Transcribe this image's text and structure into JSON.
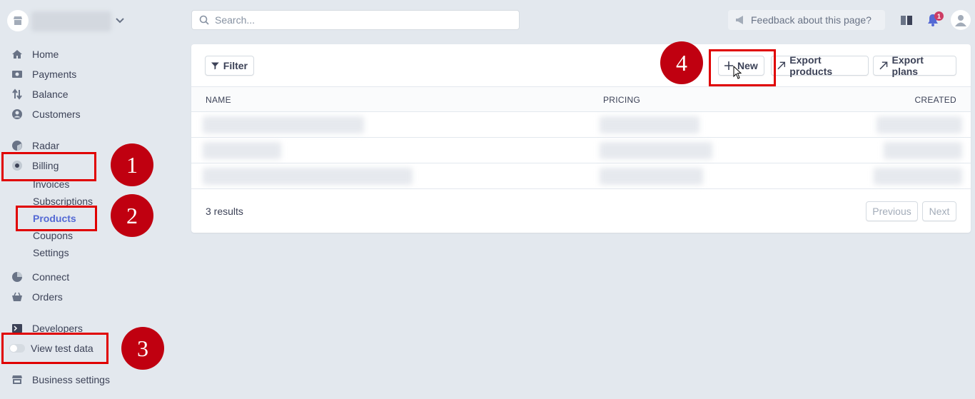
{
  "sidebar": {
    "nav": [
      {
        "label": "Home",
        "icon": "home-icon"
      },
      {
        "label": "Payments",
        "icon": "payments-icon"
      },
      {
        "label": "Balance",
        "icon": "balance-icon"
      },
      {
        "label": "Customers",
        "icon": "customers-icon"
      },
      {
        "label": "Radar",
        "icon": "radar-icon"
      },
      {
        "label": "Billing",
        "icon": "billing-icon"
      }
    ],
    "billing_sub": [
      "Invoices",
      "Subscriptions",
      "Products",
      "Coupons",
      "Settings"
    ],
    "nav2": [
      {
        "label": "Connect",
        "icon": "connect-icon"
      },
      {
        "label": "Orders",
        "icon": "orders-icon"
      },
      {
        "label": "Developers",
        "icon": "terminal-icon"
      }
    ],
    "test_data_label": "View test data",
    "business_settings": "Business settings"
  },
  "topbar": {
    "search_placeholder": "Search...",
    "feedback": "Feedback about this page?",
    "notification_count": "1"
  },
  "toolbar": {
    "filter": "Filter",
    "new": "New",
    "export_products": "Export products",
    "export_plans": "Export plans"
  },
  "table": {
    "columns": [
      "NAME",
      "PRICING",
      "CREATED"
    ],
    "results": "3 results",
    "prev": "Previous",
    "next": "Next"
  },
  "annotations": [
    "1",
    "2",
    "3",
    "4"
  ],
  "colors": {
    "accent": "#5469d4",
    "highlight": "#e00000",
    "step_badge": "#c00010",
    "background": "#e3e8ee"
  }
}
